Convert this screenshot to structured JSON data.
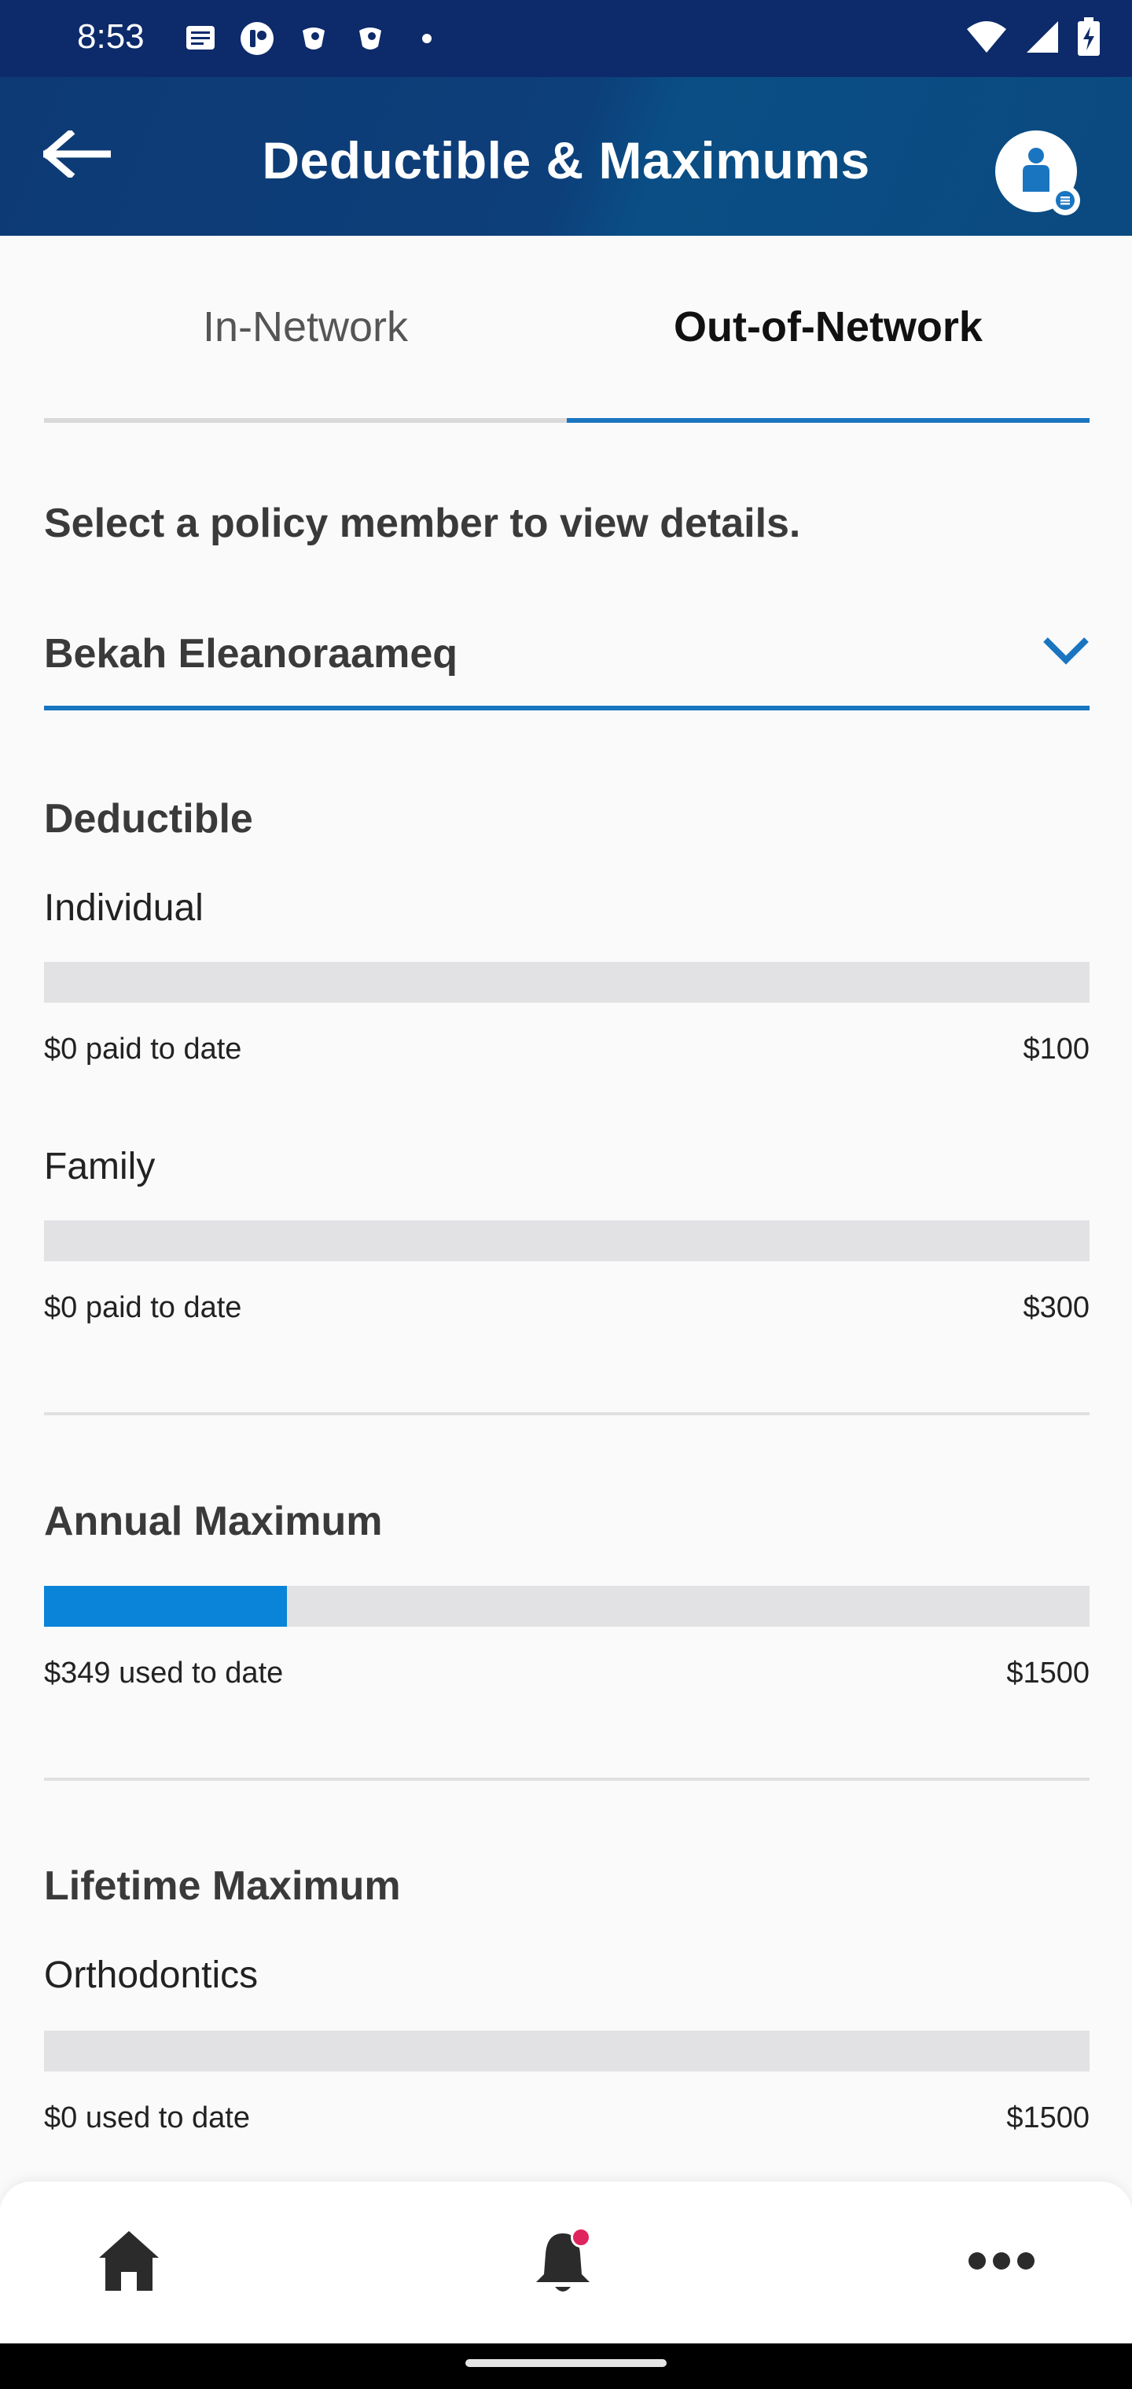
{
  "status_bar": {
    "time": "8:53",
    "notification_icons": [
      "message-icon",
      "app-icon",
      "pocket-icon",
      "pocket-icon",
      "dot-icon"
    ],
    "right_icons": [
      "wifi-icon",
      "signal-icon",
      "battery-icon"
    ]
  },
  "header": {
    "title": "Deductible & Maximums",
    "back_icon": "arrow-left-icon",
    "avatar_icon": "user-icon"
  },
  "tabs": [
    {
      "label": "In-Network",
      "active": false
    },
    {
      "label": "Out-of-Network",
      "active": true
    }
  ],
  "member_section": {
    "prompt": "Select a policy member to view details.",
    "selected_member": "Bekah Eleanoraameq"
  },
  "deductible": {
    "title": "Deductible",
    "individual": {
      "label": "Individual",
      "paid_text": "$0 paid to date",
      "max_text": "$100",
      "progress": 0
    },
    "family": {
      "label": "Family",
      "paid_text": "$0 paid to date",
      "max_text": "$300",
      "progress": 0
    }
  },
  "annual_maximum": {
    "title": "Annual Maximum",
    "used_text": "$349 used to date",
    "max_text": "$1500",
    "progress": 0.2327
  },
  "lifetime_maximum": {
    "title": "Lifetime Maximum",
    "orthodontics": {
      "label": "Orthodontics",
      "used_text": "$0 used to date",
      "max_text": "$1500",
      "progress": 0
    }
  },
  "bottom_nav": {
    "items": [
      "home-icon",
      "bell-icon",
      "more-icon"
    ],
    "notification_dot_color": "#e0245e"
  },
  "colors": {
    "header_bg": "#0d3a74",
    "accent": "#1a75c0",
    "progress_fill": "#0a84d8",
    "progress_track": "#e2e2e4"
  }
}
